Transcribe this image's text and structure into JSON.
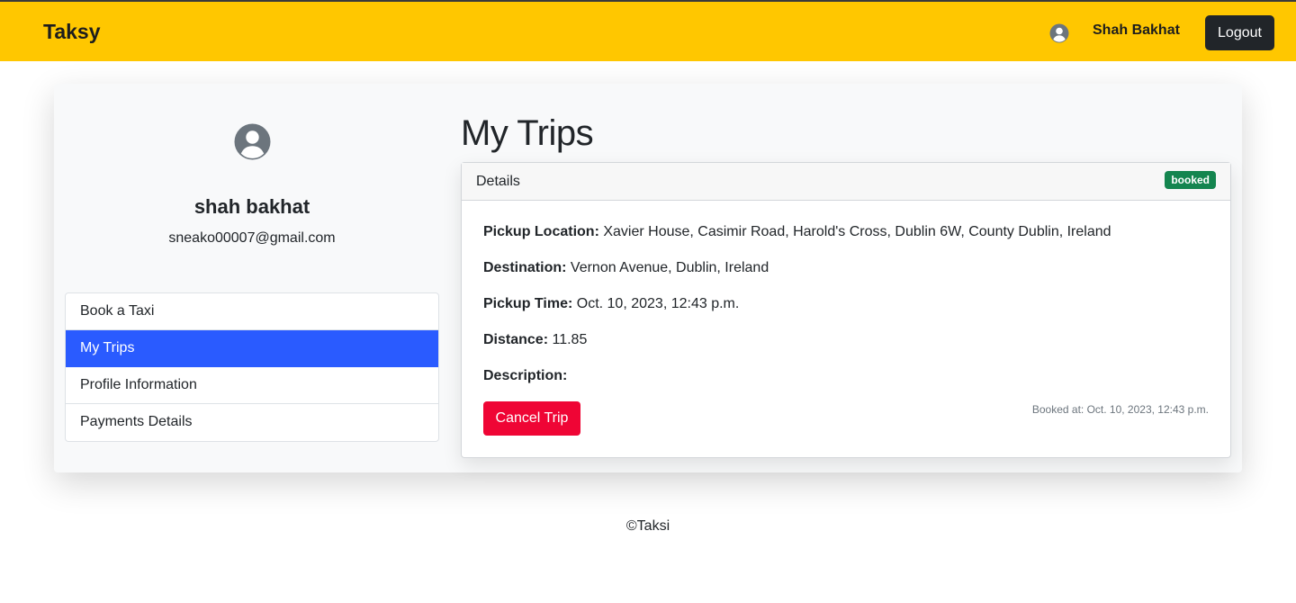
{
  "navbar": {
    "brand": "Taksy",
    "user_name": "Shah Bakhat",
    "logout_label": "Logout",
    "color": "#ffc700"
  },
  "profile": {
    "name": "shah bakhat",
    "email": "sneako00007@gmail.com",
    "avatar_icon": "user-circle-icon"
  },
  "sidebar": {
    "items": [
      {
        "label": "Book a Taxi",
        "active": false
      },
      {
        "label": "My Trips",
        "active": true
      },
      {
        "label": "Profile Information",
        "active": false
      },
      {
        "label": "Payments Details",
        "active": false
      }
    ],
    "active_color": "#2a5bff"
  },
  "main": {
    "title": "My Trips",
    "trip": {
      "header_label": "Details",
      "status": "booked",
      "status_color": "#14854f",
      "pickup_label": "Pickup Location:",
      "pickup_value": "Xavier House, Casimir Road, Harold's Cross, Dublin 6W, County Dublin, Ireland",
      "destination_label": "Destination:",
      "destination_value": "Vernon Avenue, Dublin, Ireland",
      "time_label": "Pickup Time:",
      "time_value": "Oct. 10, 2023, 12:43 p.m.",
      "distance_label": "Distance:",
      "distance_value": "11.85",
      "description_label": "Description:",
      "description_value": "",
      "cancel_label": "Cancel Trip",
      "cancel_color": "#ef0535",
      "booked_at": "Booked at: Oct. 10, 2023, 12:43 p.m."
    }
  },
  "footer": {
    "text": "©Taksi"
  }
}
